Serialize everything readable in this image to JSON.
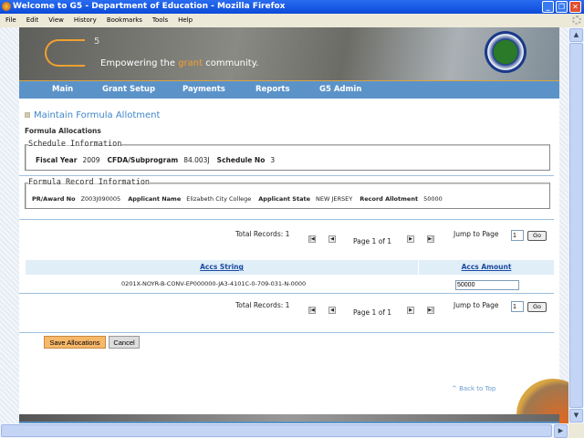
{
  "window": {
    "title": "Welcome to G5 - Department of Education - Mozilla Firefox"
  },
  "menu": [
    "File",
    "Edit",
    "View",
    "History",
    "Bookmarks",
    "Tools",
    "Help"
  ],
  "banner": {
    "logo": "G5",
    "sup": "5",
    "tagline_pre": "Empowering the ",
    "tagline_accent": "grant",
    "tagline_post": " community."
  },
  "nav": [
    "Main",
    "Grant Setup",
    "Payments",
    "Reports",
    "G5 Admin"
  ],
  "page": {
    "title": "Maintain Formula Allotment",
    "subtitle": "Formula Allocations"
  },
  "schedule": {
    "legend": "Schedule Information",
    "fiscal_year_label": "Fiscal Year",
    "fiscal_year": "2009",
    "cfda_label": "CFDA/Subprogram",
    "cfda": "84.003J",
    "schedule_label": "Schedule No",
    "schedule": "3"
  },
  "record": {
    "legend": "Formula Record Information",
    "award_label": "PR/Award No",
    "award": "Z003J090005",
    "applicant_label": "Applicant Name",
    "applicant": "Elizabeth City College",
    "state_label": "Applicant State",
    "state": "NEW JERSEY",
    "allotment_label": "Record Allotment",
    "allotment": "50000"
  },
  "pager": {
    "total": "Total Records: 1",
    "page": "Page 1 of 1",
    "jump": "Jump to Page",
    "jump_value": "1",
    "go": "Go"
  },
  "table": {
    "headers": [
      "Accs String",
      "Accs Amount"
    ],
    "rows": [
      {
        "string": "0201X-NOYR-B-CONV-EP000000-JA3-4101C-0-709-031-N-0000",
        "amount": "50000"
      }
    ]
  },
  "buttons": {
    "save": "Save Allocations",
    "cancel": "Cancel"
  },
  "footer": {
    "back_to_top": "^ Back to Top"
  },
  "colors": {
    "nav": "#5b93c9",
    "accent": "#f0a030",
    "title": "#3f86c8"
  }
}
